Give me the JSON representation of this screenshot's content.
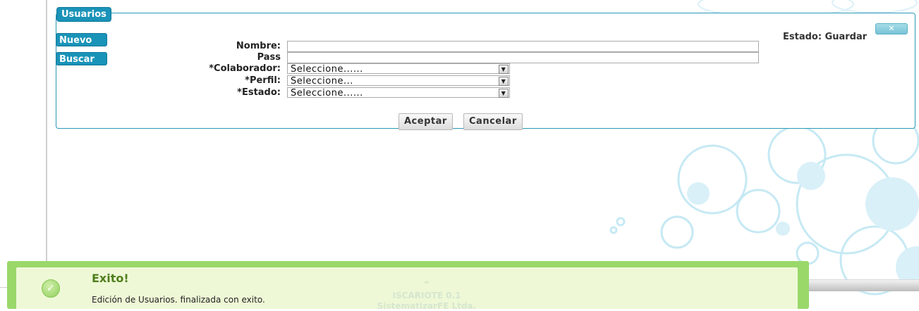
{
  "panel": {
    "title": "Usuarios",
    "estado": "Estado: Guardar"
  },
  "side_buttons": [
    "Nuevo",
    "Buscar"
  ],
  "close_symbol": "✕",
  "form": {
    "nombre_label": "Nombre:",
    "nombre_value": "",
    "pass_label": "Pass",
    "pass_value": "",
    "colaborador_label": "*Colaborador:",
    "colaborador_value": "Seleccione......",
    "perfil_label": "*Perfil:",
    "perfil_value": "Seleccione...",
    "estado_label": "*Estado:",
    "estado_value": "Seleccione......",
    "dropdown_arrow": "▼"
  },
  "actions": {
    "accept": "Aceptar",
    "cancel": "Cancelar"
  },
  "toast": {
    "title": "Exito!",
    "message": "Edición de Usuarios. finalizada con exito.",
    "icon": "check-icon",
    "check_symbol": "✓",
    "bg_color": "#9ad86a"
  },
  "footer": {
    "tilde": "=",
    "app": "ISCARIOTE 0.1",
    "company": "SistematizarFE Ltda."
  },
  "colors": {
    "accent": "#1a93b8",
    "border": "#2b97b7",
    "bubbles": "#bfe6f2"
  }
}
